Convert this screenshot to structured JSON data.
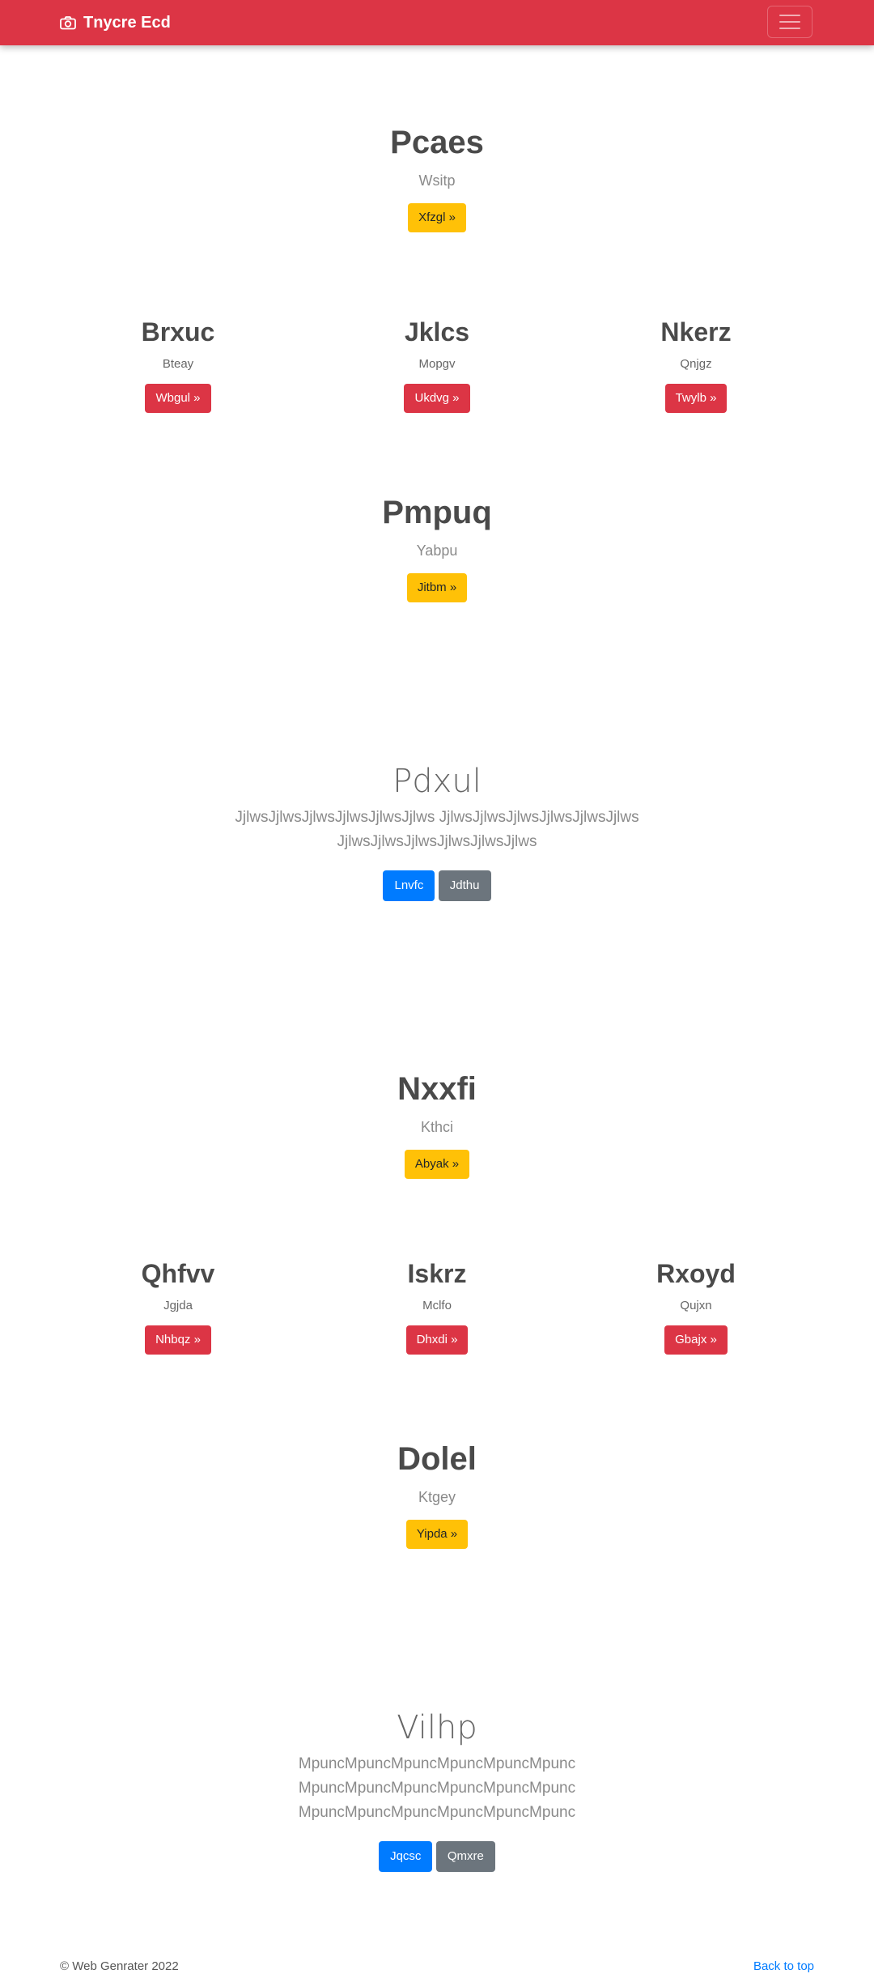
{
  "navbar": {
    "brand": "Tnycre Ecd",
    "brand_icon": "camera-icon",
    "toggler_icon": "hamburger-menu-icon",
    "color": "#dc3545"
  },
  "sections": {
    "s1": {
      "title": "Pcaes",
      "subtitle": "Wsitp",
      "button": "Xfzgl »"
    },
    "row1": [
      {
        "title": "Brxuc",
        "subtitle": "Bteay",
        "button": "Wbgul »"
      },
      {
        "title": "Jklcs",
        "subtitle": "Mopgv",
        "button": "Ukdvg »"
      },
      {
        "title": "Nkerz",
        "subtitle": "Qnjgz",
        "button": "Twylb »"
      }
    ],
    "s2": {
      "title": "Pmpuq",
      "subtitle": "Yabpu",
      "button": "Jitbm »"
    },
    "jumbo1": {
      "title": "Pdxul",
      "lines": [
        "JjlwsJjlwsJjlwsJjlwsJjlwsJjlws JjlwsJjlwsJjlwsJjlwsJjlwsJjlws",
        "JjlwsJjlwsJjlwsJjlwsJjlwsJjlws"
      ],
      "primary": "Lnvfc",
      "secondary": "Jdthu"
    },
    "s3": {
      "title": "Nxxfi",
      "subtitle": "Kthci",
      "button": "Abyak »"
    },
    "row2": [
      {
        "title": "Qhfvv",
        "subtitle": "Jgjda",
        "button": "Nhbqz »"
      },
      {
        "title": "Iskrz",
        "subtitle": "Mclfo",
        "button": "Dhxdi »"
      },
      {
        "title": "Rxoyd",
        "subtitle": "Qujxn",
        "button": "Gbajx »"
      }
    ],
    "s4": {
      "title": "Dolel",
      "subtitle": "Ktgey",
      "button": "Yipda »"
    },
    "jumbo2": {
      "title": "Vilhp",
      "lines": [
        "MpuncMpuncMpuncMpuncMpuncMpunc",
        "MpuncMpuncMpuncMpuncMpuncMpunc",
        "MpuncMpuncMpuncMpuncMpuncMpunc"
      ],
      "primary": "Jqcsc",
      "secondary": "Qmxre"
    }
  },
  "footer": {
    "copyright": "© Web Genrater 2022",
    "back_to_top": "Back to top"
  }
}
